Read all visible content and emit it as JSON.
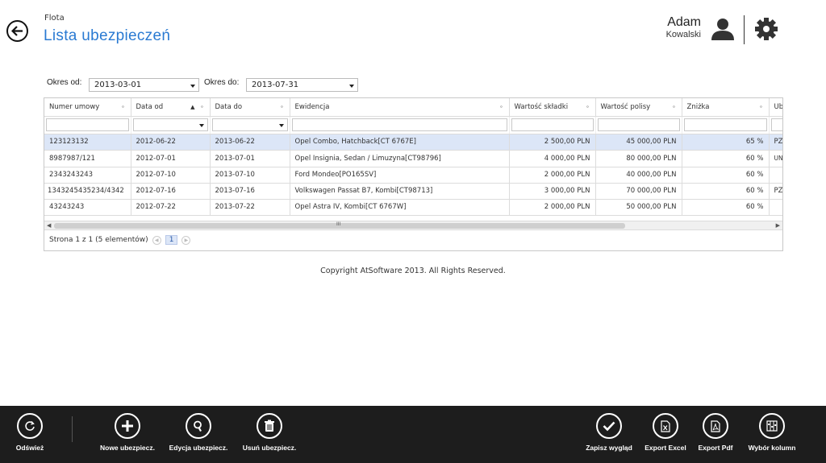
{
  "header": {
    "section": "Flota",
    "title": "Lista ubezpieczeń",
    "user_first": "Adam",
    "user_last": "Kowalski"
  },
  "filters": {
    "from_label": "Okres od:",
    "from_value": "2013-03-01",
    "to_label": "Okres do:",
    "to_value": "2013-07-31"
  },
  "grid": {
    "columns": [
      "Numer umowy",
      "Data od",
      "Data do",
      "Ewidencja",
      "Wartość składki",
      "Wartość polisy",
      "Zniżka",
      "Ub"
    ],
    "rows": [
      [
        "123123132",
        "2012-06-22",
        "2013-06-22",
        "Opel Combo, Hatchback[CT 6767E]",
        "2 500,00 PLN",
        "45 000,00 PLN",
        "65 %",
        "PZ"
      ],
      [
        "8987987/121",
        "2012-07-01",
        "2013-07-01",
        "Opel Insignia, Sedan / Limuzyna[CT98796]",
        "4 000,00 PLN",
        "80 000,00 PLN",
        "60 %",
        "UN [R"
      ],
      [
        "2343243243",
        "2012-07-10",
        "2013-07-10",
        "Ford Mondeo[PO165SV]",
        "2 000,00 PLN",
        "40 000,00 PLN",
        "60 %",
        ""
      ],
      [
        "1343245435234/4342",
        "2012-07-16",
        "2013-07-16",
        "Volkswagen Passat B7, Kombi[CT98713]",
        "3 000,00 PLN",
        "70 000,00 PLN",
        "60 %",
        "PZ"
      ],
      [
        "43243243",
        "2012-07-22",
        "2013-07-22",
        "Opel Astra IV, Kombi[CT 6767W]",
        "2 000,00 PLN",
        "50 000,00 PLN",
        "60 %",
        ""
      ]
    ],
    "scroll_grip": "III",
    "pager_text": "Strona 1 z 1 (5 elementów)",
    "pager_current": "1"
  },
  "footer": {
    "copyright": "Copyright AtSoftware 2013. All Rights Reserved."
  },
  "appbar": {
    "refresh": "Odśwież",
    "new": "Nowe ubezpiecz.",
    "edit": "Edycja ubezpiecz.",
    "delete": "Usuń ubezpiecz.",
    "save_layout": "Zapisz wygląd",
    "export_excel": "Export Excel",
    "export_pdf": "Export Pdf",
    "columns": "Wybór kolumn"
  },
  "colors": {
    "title": "#2a7ad2",
    "appbar_bg": "#1d1d1d",
    "selected_row": "#dce6f7"
  }
}
